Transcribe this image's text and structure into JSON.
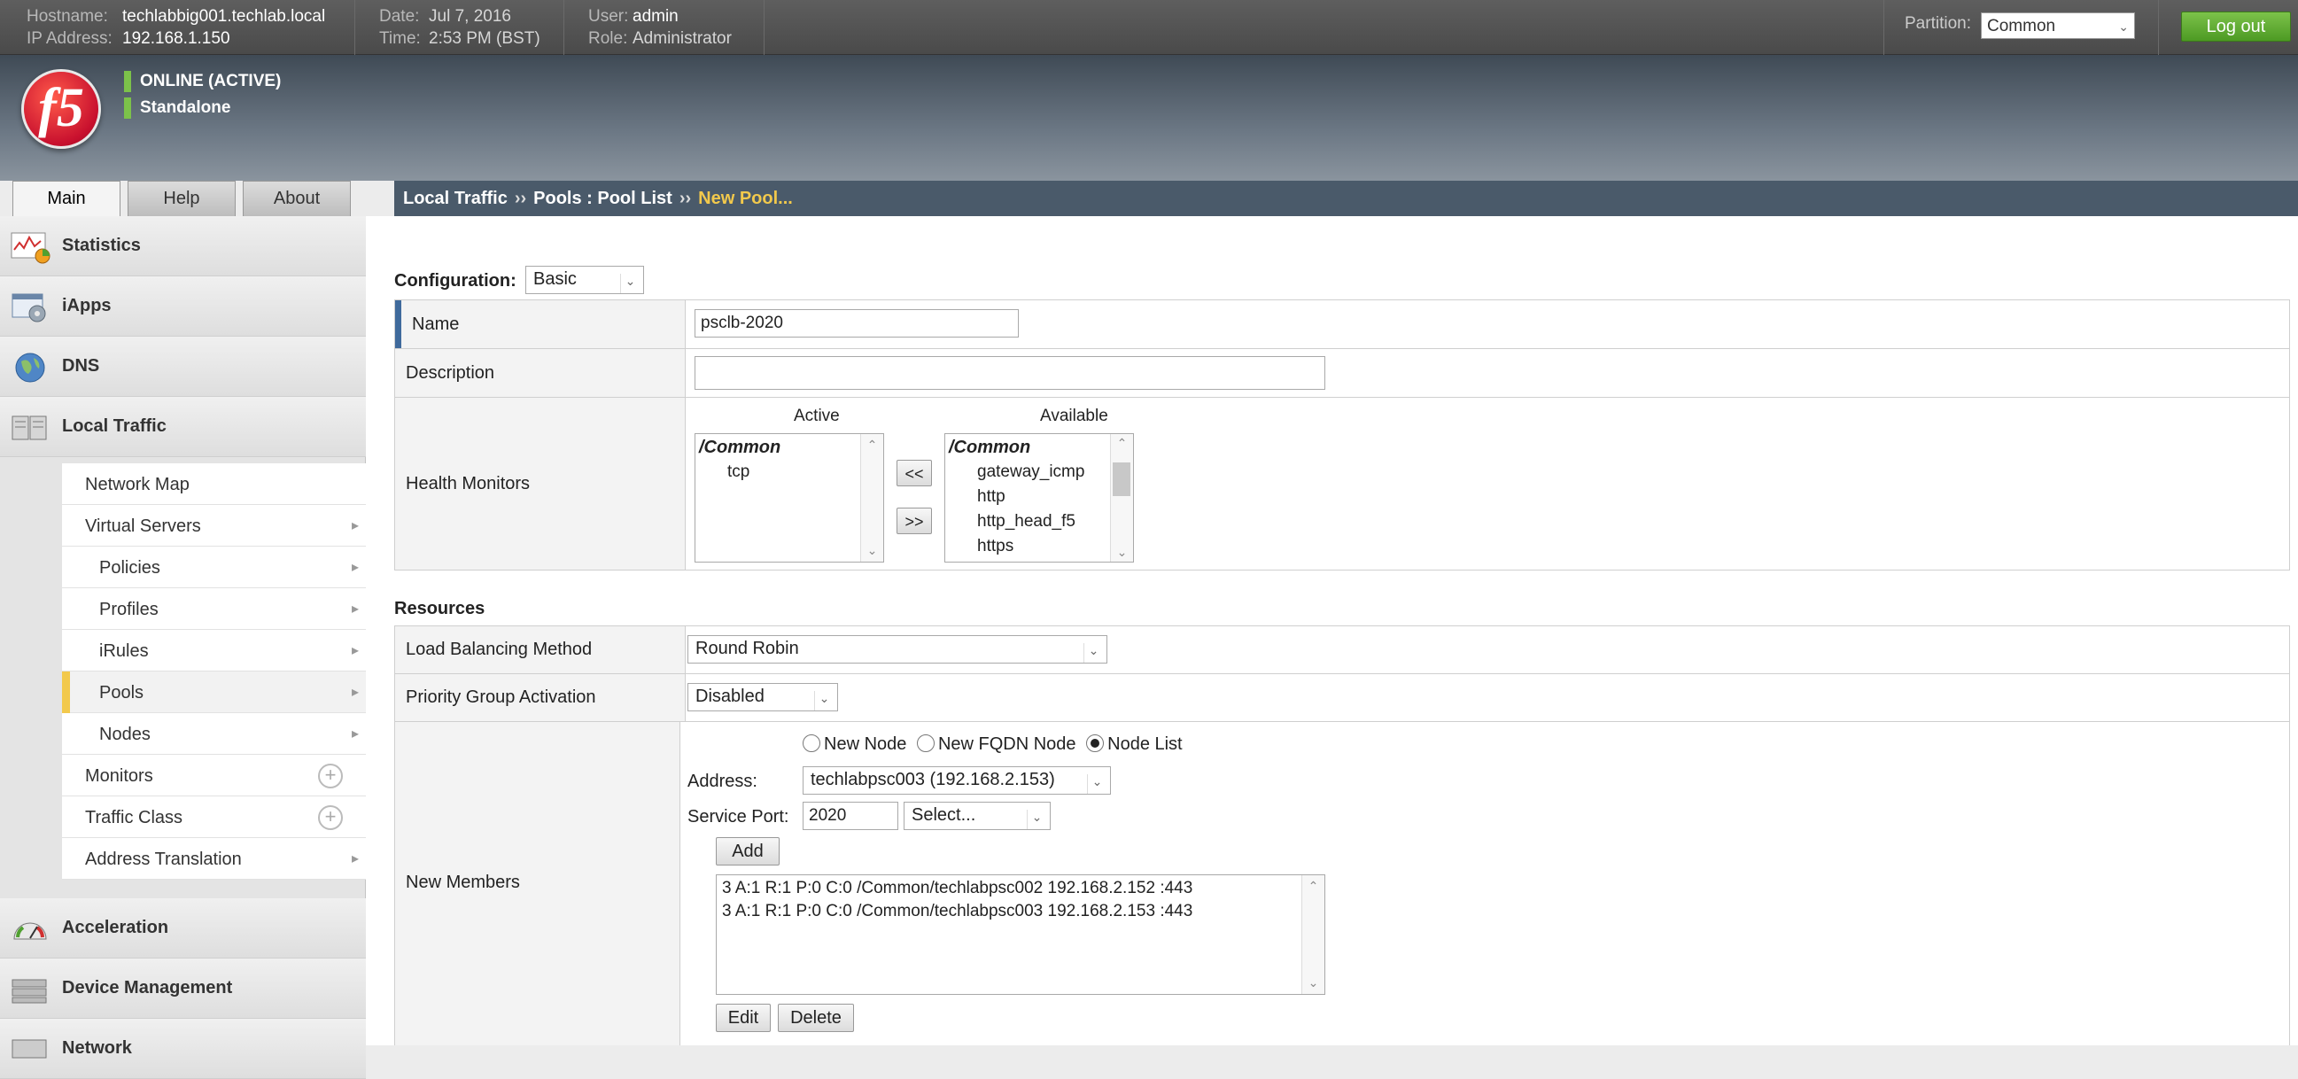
{
  "topbar": {
    "hostname_label": "Hostname:",
    "hostname": "techlabbig001.techlab.local",
    "ip_label": "IP Address:",
    "ip": "192.168.1.150",
    "date_label": "Date:",
    "date": "Jul 7, 2016",
    "time_label": "Time:",
    "time": "2:53 PM (BST)",
    "user_label": "User:",
    "user": "admin",
    "role_label": "Role:",
    "role": "Administrator",
    "partition_label": "Partition:",
    "partition_value": "Common",
    "logout_label": "Log out"
  },
  "header": {
    "logo_text": "f5",
    "status_online": "ONLINE (ACTIVE)",
    "status_mode": "Standalone",
    "status_color": "#7cc24a"
  },
  "tabs": [
    {
      "label": "Main",
      "active": true
    },
    {
      "label": "Help",
      "active": false
    },
    {
      "label": "About",
      "active": false
    }
  ],
  "sidebar": {
    "top_items": [
      {
        "label": "Statistics",
        "icon": "statistics-icon"
      },
      {
        "label": "iApps",
        "icon": "iapps-icon"
      },
      {
        "label": "DNS",
        "icon": "dns-globe-icon"
      },
      {
        "label": "Local Traffic",
        "icon": "local-traffic-icon"
      }
    ],
    "sub_items": [
      {
        "label": "Network Map",
        "indent": false,
        "arrow": false,
        "plus": false
      },
      {
        "label": "Virtual Servers",
        "indent": false,
        "arrow": true,
        "plus": false
      },
      {
        "label": "Policies",
        "indent": true,
        "arrow": true,
        "plus": false
      },
      {
        "label": "Profiles",
        "indent": true,
        "arrow": true,
        "plus": false
      },
      {
        "label": "iRules",
        "indent": true,
        "arrow": true,
        "plus": false
      },
      {
        "label": "Pools",
        "indent": true,
        "arrow": true,
        "plus": false,
        "selected": true
      },
      {
        "label": "Nodes",
        "indent": true,
        "arrow": true,
        "plus": false
      },
      {
        "label": "Monitors",
        "indent": false,
        "arrow": false,
        "plus": true
      },
      {
        "label": "Traffic Class",
        "indent": false,
        "arrow": false,
        "plus": true
      },
      {
        "label": "Address Translation",
        "indent": false,
        "arrow": true,
        "plus": false
      }
    ],
    "bottom_items": [
      {
        "label": "Acceleration",
        "icon": "gauge-icon"
      },
      {
        "label": "Device Management",
        "icon": "device-icon"
      },
      {
        "label": "Network",
        "icon": "network-icon"
      }
    ]
  },
  "breadcrumb": {
    "part1": "Local Traffic",
    "sep": "››",
    "part2": "Pools : Pool List",
    "current": "New Pool...",
    "current_color": "#f2c94c"
  },
  "configuration": {
    "label": "Configuration:",
    "value": "Basic"
  },
  "form": {
    "name_label": "Name",
    "name_value": "psclb-2020",
    "description_label": "Description",
    "description_value": "",
    "health_label": "Health Monitors",
    "active_heading": "Active",
    "available_heading": "Available",
    "active_group": "/Common",
    "active_items": [
      "tcp"
    ],
    "available_group": "/Common",
    "available_items": [
      "gateway_icmp",
      "http",
      "http_head_f5",
      "https"
    ],
    "move_left_label": "<<",
    "move_right_label": ">>"
  },
  "resources": {
    "title": "Resources",
    "lb_label": "Load Balancing Method",
    "lb_value": "Round Robin",
    "pga_label": "Priority Group Activation",
    "pga_value": "Disabled",
    "members_label": "New Members",
    "radio_new_node": "New Node",
    "radio_fqdn": "New FQDN Node",
    "radio_list": "Node List",
    "selected_radio": "Node List",
    "address_label": "Address:",
    "address_value": "techlabpsc003 (192.168.2.153)",
    "port_label": "Service Port:",
    "port_value": "2020",
    "port_select": "Select...",
    "add_label": "Add",
    "members": [
      "3 A:1 R:1 P:0 C:0 /Common/techlabpsc002 192.168.2.152 :443",
      "3 A:1 R:1 P:0 C:0 /Common/techlabpsc003 192.168.2.153 :443"
    ],
    "edit_label": "Edit",
    "delete_label": "Delete"
  }
}
